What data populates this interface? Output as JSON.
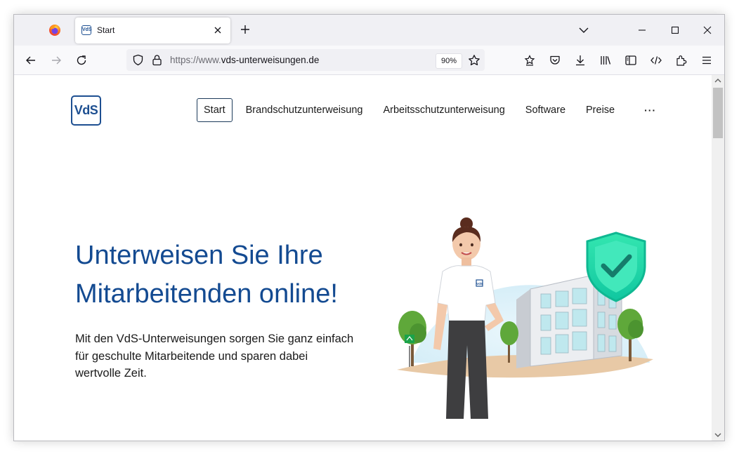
{
  "browser": {
    "tab": {
      "title": "Start",
      "favicon_text": "VdS"
    },
    "url": {
      "prefix": "https://www.",
      "domain": "vds-unterweisungen.de"
    },
    "zoom": "90%"
  },
  "site": {
    "logo_text": "VdS",
    "nav": {
      "items": [
        {
          "label": "Start"
        },
        {
          "label": "Brandschutzunterweisung"
        },
        {
          "label": "Arbeitsschutzunterweisung"
        },
        {
          "label": "Software"
        },
        {
          "label": "Preise"
        }
      ],
      "more": "···"
    },
    "hero": {
      "title": "Unterweisen Sie Ihre Mitarbeitenden online!",
      "text": "Mit den VdS-Unterweisungen sorgen Sie ganz einfach für geschulte Mitarbeitende und sparen dabei wertvolle Zeit.",
      "badge_text": "VdS"
    }
  },
  "colors": {
    "brand_blue": "#134a91",
    "shield_green": "#2ee6a8",
    "browser_chrome": "#f0f0f4"
  }
}
